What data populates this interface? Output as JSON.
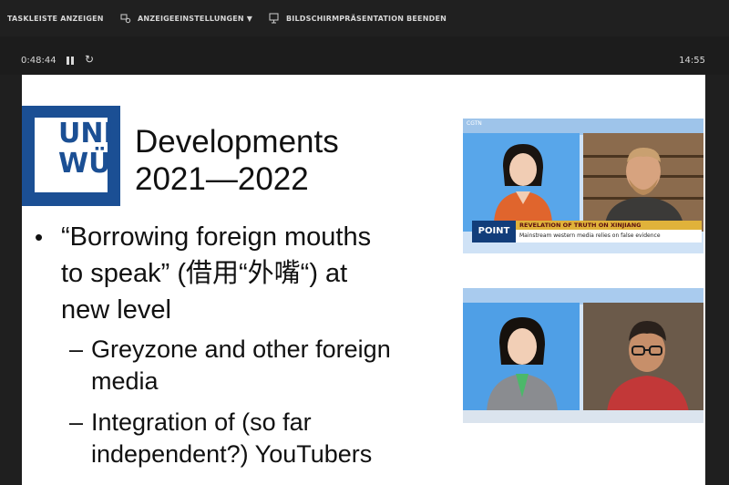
{
  "toolbar": {
    "show_taskbar": "TASKLEISTE ANZEIGEN",
    "display_settings": "ANZEIGEEINSTELLUNGEN ▼",
    "end_slideshow": "BILDSCHIRMPRÄSENTATION BEENDEN"
  },
  "timer": {
    "elapsed": "0:48:44",
    "reset_glyph": "↻",
    "clock": "14:55"
  },
  "slide": {
    "logo_line1": "UNI",
    "logo_line2": "WÜ",
    "title_line1": "Developments",
    "title_line2": "2021—2022",
    "bullet_glyph": "•",
    "bullet_line1": "“Borrowing foreign mouths",
    "bullet_line2": "to speak” (借用“外嘴“) at",
    "bullet_line3": "new level",
    "dash_glyph": "–",
    "sub1_line1": "Greyzone and other foreign",
    "sub1_line2": "media",
    "sub2_line1": "Integration of (so far",
    "sub2_line2": "independent?) YouTubers"
  },
  "video1": {
    "network": "CGTN",
    "program": "POINT",
    "headline": "REVELATION OF TRUTH ON XINJIANG",
    "subline": "Mainstream western media relies on false evidence"
  },
  "colors": {
    "uni_blue": "#1b4f94",
    "toolbar_bg": "#202020",
    "slide_bg": "#ffffff"
  }
}
